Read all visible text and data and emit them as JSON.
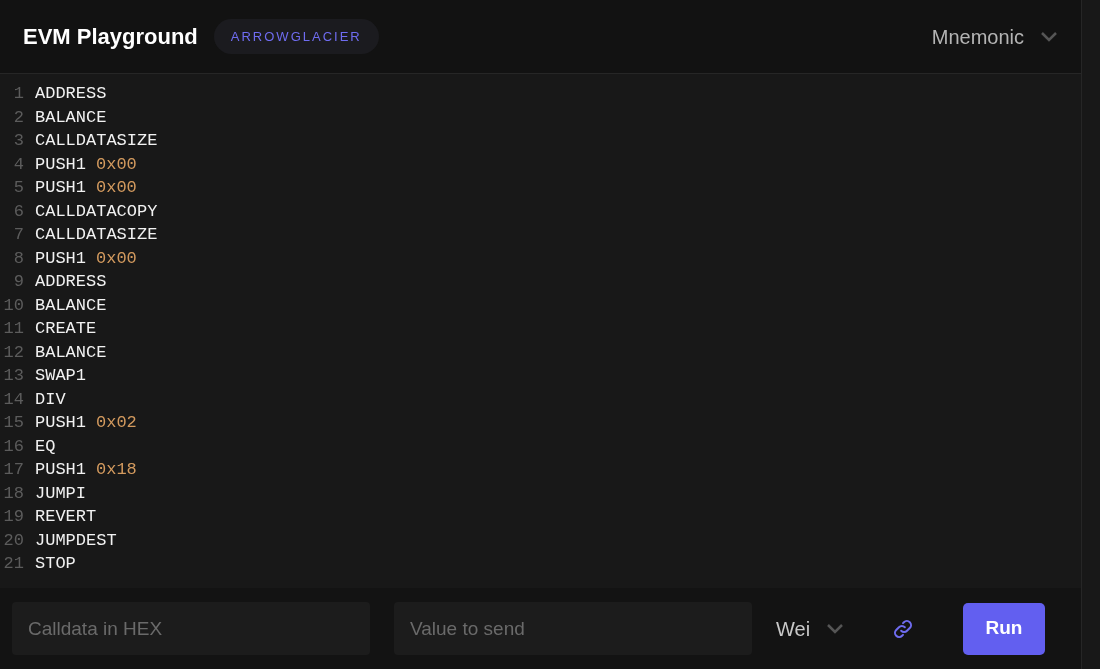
{
  "header": {
    "title": "EVM Playground",
    "fork": "ARROWGLACIER",
    "mode": "Mnemonic"
  },
  "editor": {
    "lines": [
      {
        "number": "1",
        "opcode": "ADDRESS"
      },
      {
        "number": "2",
        "opcode": "BALANCE"
      },
      {
        "number": "3",
        "opcode": "CALLDATASIZE"
      },
      {
        "number": "4",
        "opcode": "PUSH1",
        "argument": "0x00"
      },
      {
        "number": "5",
        "opcode": "PUSH1",
        "argument": "0x00"
      },
      {
        "number": "6",
        "opcode": "CALLDATACOPY"
      },
      {
        "number": "7",
        "opcode": "CALLDATASIZE"
      },
      {
        "number": "8",
        "opcode": "PUSH1",
        "argument": "0x00"
      },
      {
        "number": "9",
        "opcode": "ADDRESS"
      },
      {
        "number": "10",
        "opcode": "BALANCE"
      },
      {
        "number": "11",
        "opcode": "CREATE"
      },
      {
        "number": "12",
        "opcode": "BALANCE"
      },
      {
        "number": "13",
        "opcode": "SWAP1"
      },
      {
        "number": "14",
        "opcode": "DIV"
      },
      {
        "number": "15",
        "opcode": "PUSH1",
        "argument": "0x02"
      },
      {
        "number": "16",
        "opcode": "EQ"
      },
      {
        "number": "17",
        "opcode": "PUSH1",
        "argument": "0x18"
      },
      {
        "number": "18",
        "opcode": "JUMPI"
      },
      {
        "number": "19",
        "opcode": "REVERT"
      },
      {
        "number": "20",
        "opcode": "JUMPDEST"
      },
      {
        "number": "21",
        "opcode": "STOP"
      }
    ]
  },
  "footer": {
    "calldata": {
      "placeholder": "Calldata in HEX"
    },
    "value": {
      "placeholder": "Value to send"
    },
    "unit": "Wei",
    "run_button": "Run"
  }
}
